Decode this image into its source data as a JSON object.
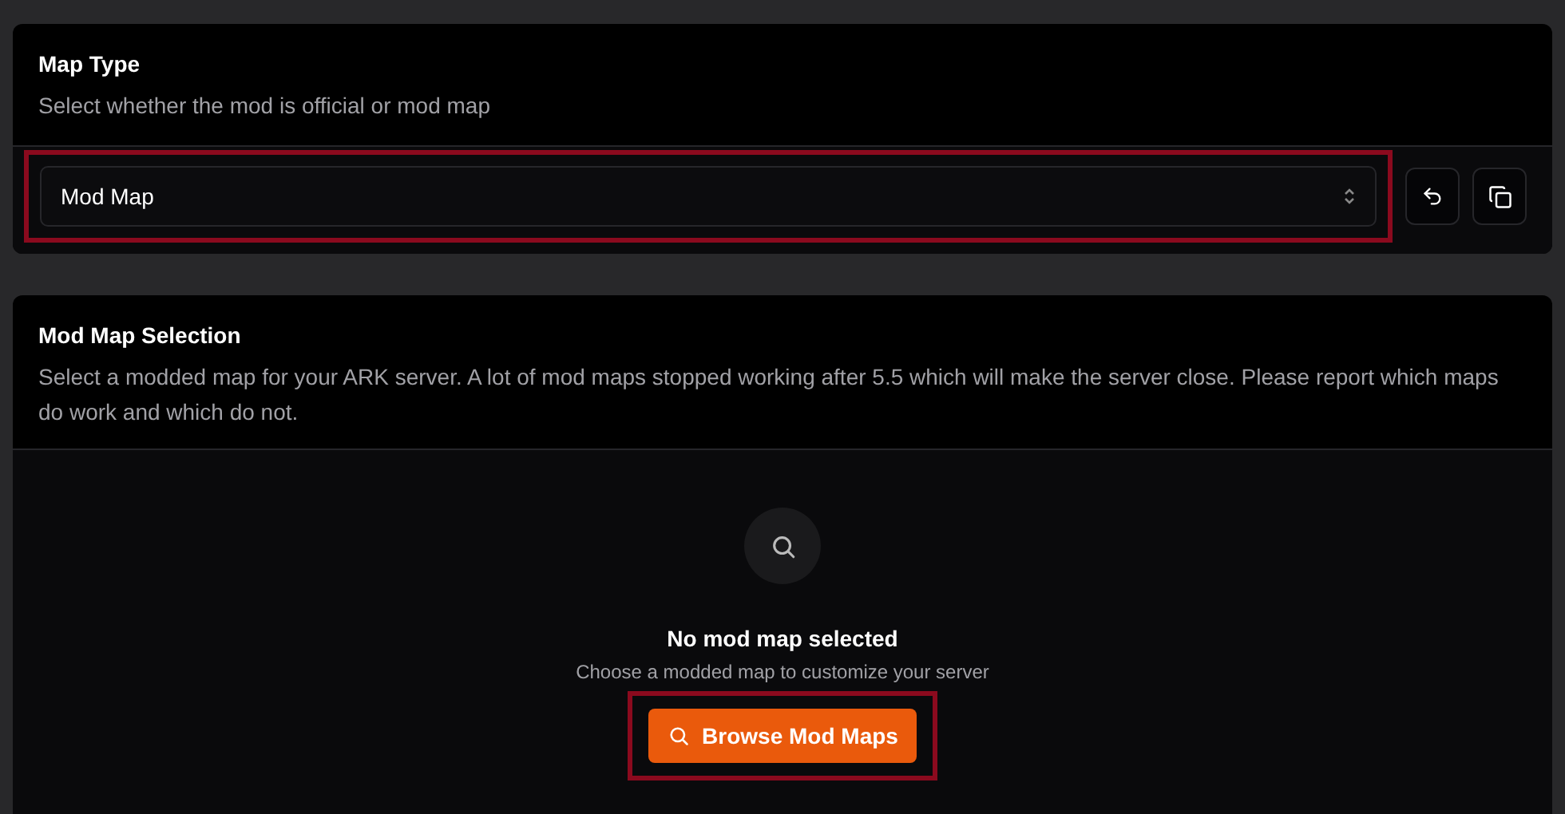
{
  "map_type": {
    "title": "Map Type",
    "description": "Select whether the mod is official or mod map",
    "select": {
      "value": "Mod Map",
      "highlighted": true
    },
    "actions": [
      {
        "kind": "reset"
      },
      {
        "kind": "copy"
      }
    ]
  },
  "mod_map_selection": {
    "title": "Mod Map Selection",
    "description": "Select a modded map for your ARK server. A lot of mod maps stopped working after 5.5 which will make the server close. Please report which maps do work and which do not.",
    "empty_state": {
      "title": "No mod map selected",
      "subtitle": "Choose a modded map to customize your server"
    },
    "button": {
      "label": "Browse Mod Maps",
      "highlighted": true
    }
  }
}
